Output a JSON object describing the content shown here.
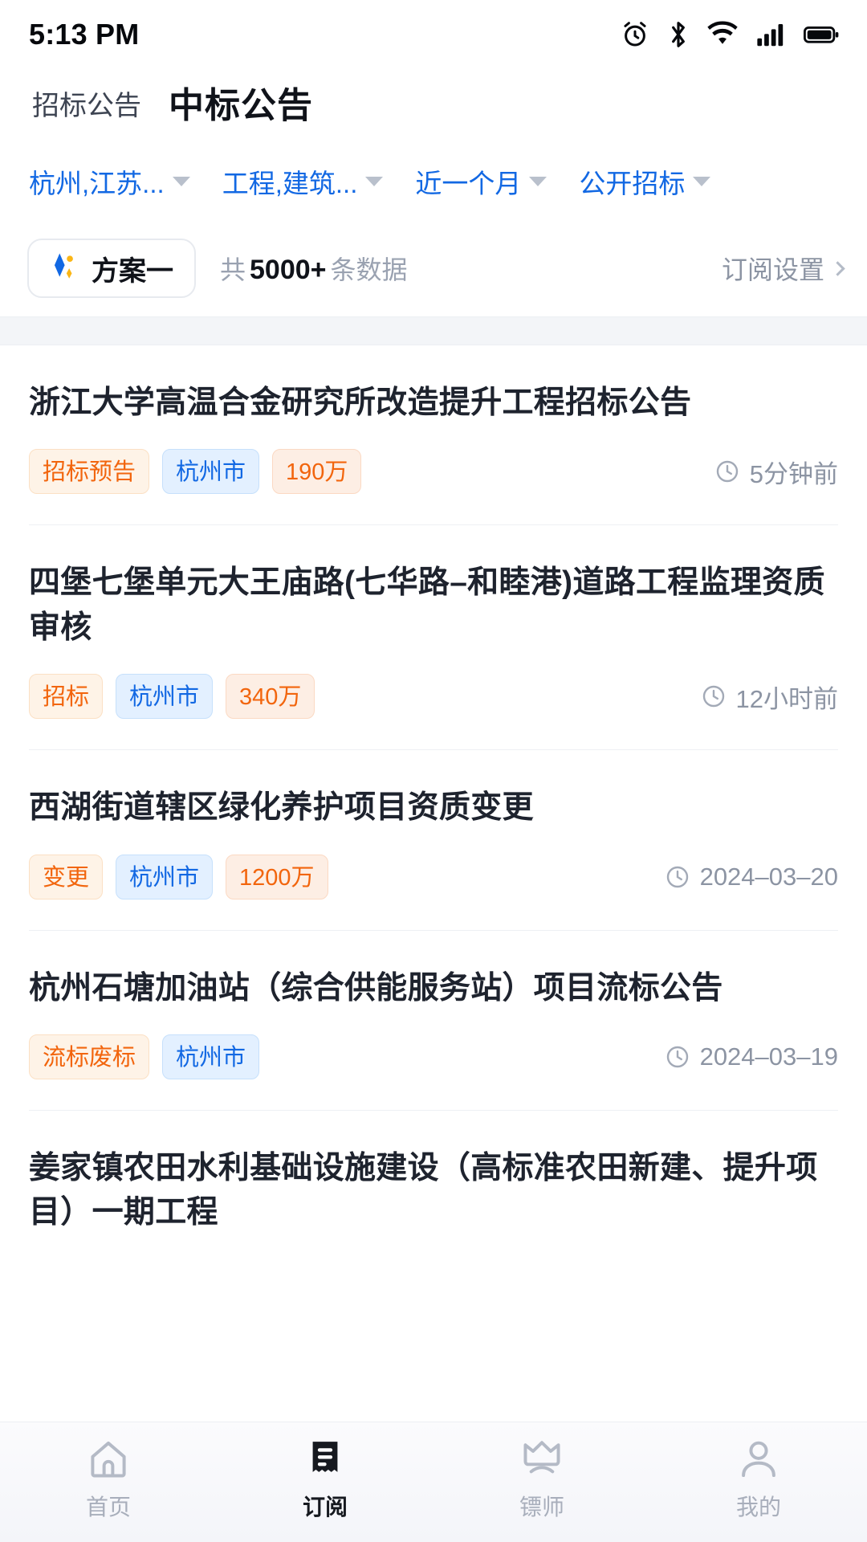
{
  "status_bar": {
    "time": "5:13 PM",
    "icons": [
      "alarm-icon",
      "bluetooth-icon",
      "wifi-icon",
      "cellular-signal-icon",
      "battery-icon"
    ]
  },
  "header": {
    "tabs": [
      {
        "label": "招标公告",
        "active": false
      },
      {
        "label": "中标公告",
        "active": true
      }
    ]
  },
  "filters": [
    {
      "label": "杭州,江苏...",
      "caret": "chevron-down-icon"
    },
    {
      "label": "工程,建筑...",
      "caret": "chevron-down-icon"
    },
    {
      "label": "近一个月",
      "caret": "chevron-down-icon"
    },
    {
      "label": "公开招标",
      "caret": "chevron-down-icon"
    }
  ],
  "subscription_bar": {
    "plan_label": "方案一",
    "plan_icon": "diamond-sparkle-icon",
    "count_prefix": "共",
    "count_value": "5000+",
    "count_suffix": "条数据",
    "settings_label": "订阅设置",
    "settings_chevron": "chevron-right-icon"
  },
  "list": [
    {
      "title": "浙江大学高温合金研究所改造提升工程招标公告",
      "tags": [
        {
          "text": "招标预告",
          "style": "orange"
        },
        {
          "text": "杭州市",
          "style": "blue"
        },
        {
          "text": "190万",
          "style": "amount"
        }
      ],
      "time": "5分钟前"
    },
    {
      "title": "四堡七堡单元大王庙路(七华路–和睦港)道路工程监理资质审核",
      "tags": [
        {
          "text": "招标",
          "style": "orange"
        },
        {
          "text": "杭州市",
          "style": "blue"
        },
        {
          "text": "340万",
          "style": "amount"
        }
      ],
      "time": "12小时前"
    },
    {
      "title": "西湖街道辖区绿化养护项目资质变更",
      "tags": [
        {
          "text": "变更",
          "style": "orange"
        },
        {
          "text": "杭州市",
          "style": "blue"
        },
        {
          "text": "1200万",
          "style": "amount"
        }
      ],
      "time": "2024–03–20"
    },
    {
      "title": "杭州石塘加油站（综合供能服务站）项目流标公告",
      "tags": [
        {
          "text": "流标废标",
          "style": "orange"
        },
        {
          "text": "杭州市",
          "style": "blue"
        }
      ],
      "time": "2024–03–19"
    },
    {
      "title": "姜家镇农田水利基础设施建设（高标准农田新建、提升项目）一期工程",
      "tags": [],
      "time": ""
    }
  ],
  "tabbar": [
    {
      "label": "首页",
      "icon": "home-icon",
      "active": false
    },
    {
      "label": "订阅",
      "icon": "document-list-icon",
      "active": true
    },
    {
      "label": "镖师",
      "icon": "crown-icon",
      "active": false
    },
    {
      "label": "我的",
      "icon": "person-icon",
      "active": false
    }
  ],
  "colors": {
    "accent_blue": "#1268e3",
    "tag_orange_text": "#f2650d",
    "tag_orange_bg": "#fef3e7",
    "tag_blue_text": "#1268e3",
    "tag_blue_bg": "#e3f0ff",
    "title_text": "#1e232e",
    "muted_text": "#8c94a3"
  }
}
